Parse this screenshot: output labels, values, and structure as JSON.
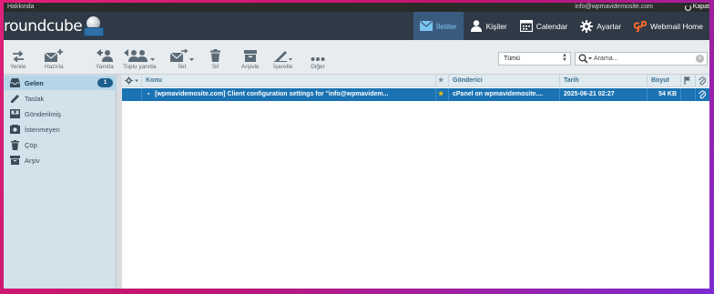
{
  "topbar": {
    "about": "Hakkında",
    "user_email": "info@wpmavidemosite.com",
    "logout": "Kapat"
  },
  "logo": {
    "text": "roundcube"
  },
  "nav": [
    {
      "label": "İletiler",
      "icon": "envelope-icon",
      "active": true
    },
    {
      "label": "Kişiler",
      "icon": "person-icon"
    },
    {
      "label": "Calendar",
      "icon": "calendar-icon"
    },
    {
      "label": "Ayarlar",
      "icon": "gear-icon"
    },
    {
      "label": "Webmail Home",
      "icon": "cpanel-icon"
    }
  ],
  "toolbar": {
    "refresh": "Yenile",
    "compose": "Hazırla",
    "reply": "Yanıtla",
    "reply_all": "Toplu yanıtla",
    "forward": "İlet",
    "delete": "Sil",
    "archive": "Arşivle",
    "mark": "İşaretle",
    "more": "Diğer"
  },
  "filter": {
    "value": "Tümü"
  },
  "search": {
    "placeholder": "Arama..."
  },
  "folders": [
    {
      "label": "Gelen",
      "count": "1",
      "icon": "inbox-icon",
      "active": true
    },
    {
      "label": "Taslak",
      "icon": "pencil-icon"
    },
    {
      "label": "Gönderilmiş",
      "icon": "sent-icon"
    },
    {
      "label": "İstenmeyen",
      "icon": "junk-icon"
    },
    {
      "label": "Çöp",
      "icon": "trash-icon"
    },
    {
      "label": "Arşiv",
      "icon": "archive-icon"
    }
  ],
  "columns": {
    "subject": "Konu",
    "from": "Gönderici",
    "date": "Tarih",
    "size": "Boyut"
  },
  "messages": [
    {
      "subject": "[wpmavidemosite.com] Client configuration settings for \"info@wpmavidem...",
      "from": "cPanel on wpmavidemosite....",
      "date": "2025-06-21 02:27",
      "size": "54 KB"
    }
  ],
  "colors": {
    "header_bg": "#2f3a46",
    "nav_active": "#3a5b7e",
    "selected_row": "#1b73b3",
    "sidebar_bg": "#d2e1ea",
    "cpanel_orange": "#ff6c2c"
  }
}
